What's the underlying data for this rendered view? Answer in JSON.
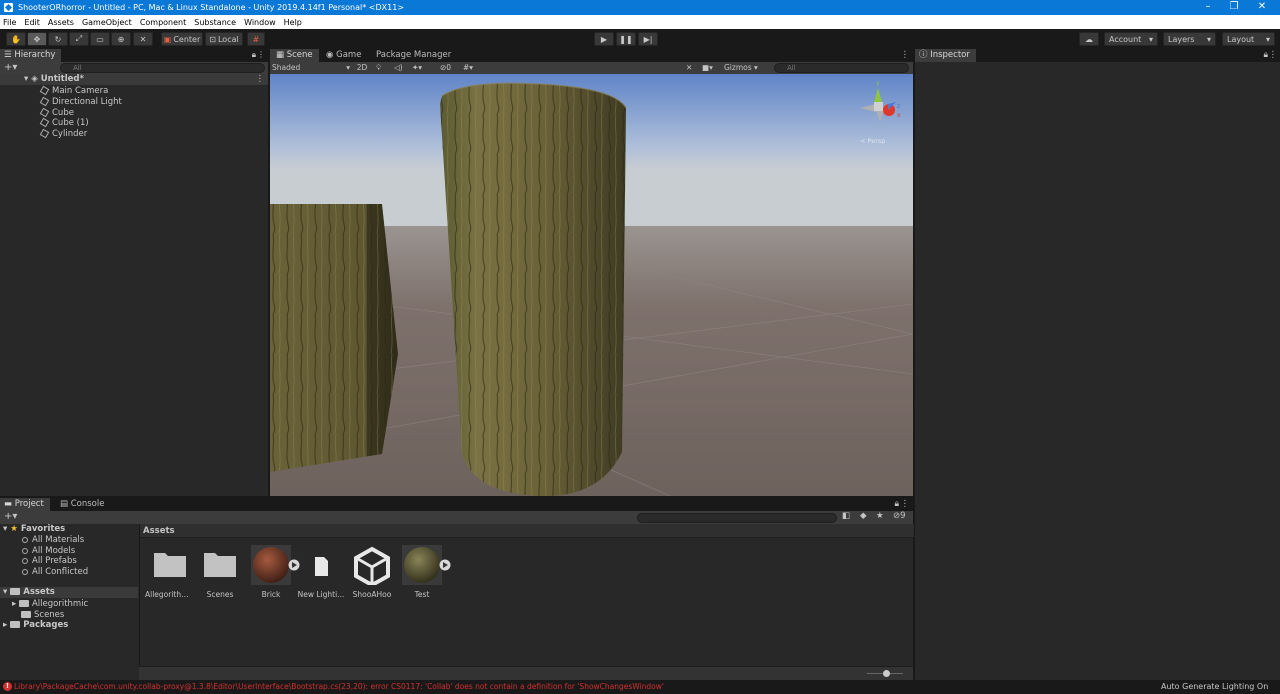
{
  "window": {
    "title": "ShooterORhorror - Untitled - PC, Mac & Linux Standalone - Unity 2019.4.14f1 Personal* <DX11>"
  },
  "menu": [
    "File",
    "Edit",
    "Assets",
    "GameObject",
    "Component",
    "Substance",
    "Window",
    "Help"
  ],
  "toolbar": {
    "center_label": "Center",
    "local_label": "Local",
    "account_label": "Account",
    "layers_label": "Layers",
    "layout_label": "Layout"
  },
  "hierarchy": {
    "tab_label": "Hierarchy",
    "search_placeholder": "All",
    "scene_name": "Untitled*",
    "items": [
      "Main Camera",
      "Directional Light",
      "Cube",
      "Cube (1)",
      "Cylinder"
    ]
  },
  "scene_view": {
    "tabs": [
      "Scene",
      "Game",
      "Package Manager"
    ],
    "shading_mode": "Shaded",
    "mode_2d": "2D",
    "fx_count": "0",
    "gizmos_label": "Gizmos",
    "search_placeholder": "All",
    "gizmo_axes": {
      "y": "y",
      "x": "x",
      "z": "z"
    },
    "persp_label": "< Persp"
  },
  "inspector": {
    "tab_label": "Inspector"
  },
  "project": {
    "tabs": [
      "Project",
      "Console"
    ],
    "favorites_label": "Favorites",
    "favorites": [
      "All Materials",
      "All Models",
      "All Prefabs",
      "All Conflicted"
    ],
    "assets_label": "Assets",
    "asset_folders": [
      "Allegorithmic",
      "Scenes"
    ],
    "packages_label": "Packages",
    "breadcrumb": "Assets",
    "hidden_count": "9",
    "assets": [
      "Allegorithm...",
      "Scenes",
      "Brick",
      "New Lighti...",
      "ShooAHoo",
      "Test"
    ]
  },
  "status": {
    "error_text": "Library\\PackageCache\\com.unity.collab-proxy@1.3.8\\Editor\\UserInterface\\Bootstrap.cs(23,20): error CS0117: 'Collab' does not contain a definition for 'ShowChangesWindow'",
    "right_text": "Auto Generate Lighting On"
  },
  "colors": {
    "accent": "#0a78d7",
    "error": "#d33030",
    "selection": "#3e5f96"
  }
}
